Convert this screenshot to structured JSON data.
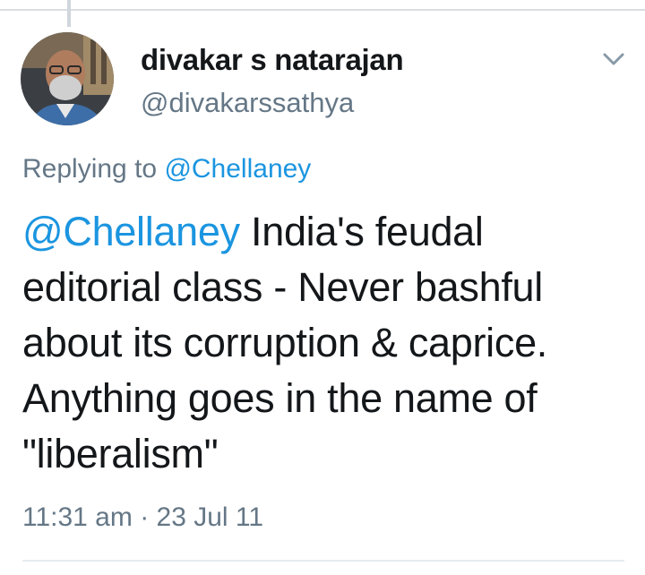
{
  "tweet": {
    "author": {
      "name": "divakar s natarajan",
      "handle": "@divakarssathya"
    },
    "reply_context": {
      "prefix": "Replying to",
      "mention": "@Chellaney"
    },
    "body": {
      "mention": "@Chellaney",
      "text": "India's feudal editorial class - Never bashful about its corruption & caprice. Anything goes in the name of \"liberalism\""
    },
    "timestamp": "11:31 am · 23 Jul 11",
    "menu_icon": "chevron-down-icon"
  },
  "colors": {
    "text_primary": "#14171a",
    "text_secondary": "#657786",
    "link": "#1b95e0",
    "divider": "#e6ecf0"
  }
}
